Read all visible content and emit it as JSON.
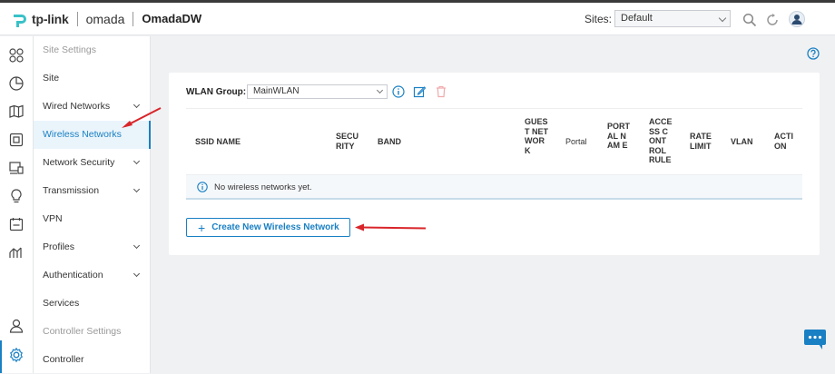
{
  "header": {
    "brand": "tp-link",
    "product": "omada",
    "site_name": "OmadaDW",
    "sites_label": "Sites:",
    "site_selected": "Default"
  },
  "iconbar": {
    "icons": [
      "dashboard-icon",
      "statistics-icon",
      "map-icon",
      "devices-icon",
      "clients-icon",
      "insight-icon",
      "log-icon",
      "reports-icon",
      "account-icon",
      "settings-icon"
    ]
  },
  "sidebar": {
    "items": [
      {
        "label": "Site Settings",
        "kind": "header"
      },
      {
        "label": "Site",
        "kind": "item"
      },
      {
        "label": "Wired Networks",
        "kind": "expand"
      },
      {
        "label": "Wireless Networks",
        "kind": "active"
      },
      {
        "label": "Network Security",
        "kind": "expand"
      },
      {
        "label": "Transmission",
        "kind": "expand"
      },
      {
        "label": "VPN",
        "kind": "item"
      },
      {
        "label": "Profiles",
        "kind": "expand"
      },
      {
        "label": "Authentication",
        "kind": "expand"
      },
      {
        "label": "Services",
        "kind": "item"
      },
      {
        "label": "Controller Settings",
        "kind": "header"
      },
      {
        "label": "Controller",
        "kind": "item"
      }
    ]
  },
  "wlan": {
    "label": "WLAN Group:",
    "selected": "MainWLAN"
  },
  "table": {
    "columns": [
      "SSID NAME",
      "SECU RITY",
      "BAND",
      "GUES T NET WOR K",
      "Portal",
      "PORT AL NAM E",
      "ACCE SS CONT ROL RULE",
      "RATE LIMIT",
      "VLAN",
      "ACTI ON"
    ],
    "empty_text": "No wireless networks yet."
  },
  "actions": {
    "create_label": "Create New Wireless Network"
  },
  "colors": {
    "accent": "#1a80c4",
    "annotation_red": "#d9252a",
    "brand_teal": "#39c1c7"
  }
}
